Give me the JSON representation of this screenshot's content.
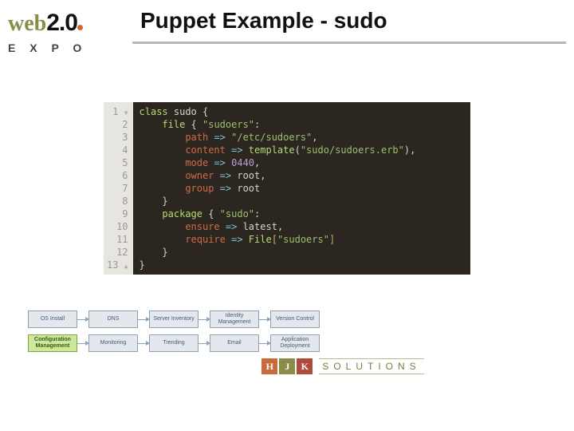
{
  "header": {
    "logo_web": "web",
    "logo_20": "2.0",
    "logo_expo": "E X P O",
    "title": "Puppet Example - sudo"
  },
  "code": {
    "line_numbers": [
      "1",
      "2",
      "3",
      "4",
      "5",
      "6",
      "7",
      "8",
      "9",
      "10",
      "11",
      "12",
      "13"
    ],
    "tokens": [
      [
        {
          "t": "class ",
          "c": "kw"
        },
        {
          "t": "sudo ",
          "c": "id"
        },
        {
          "t": "{",
          "c": "punc"
        }
      ],
      [
        {
          "t": "    ",
          "c": "id"
        },
        {
          "t": "file ",
          "c": "kw"
        },
        {
          "t": "{ ",
          "c": "punc"
        },
        {
          "t": "\"sudoers\"",
          "c": "str"
        },
        {
          "t": ":",
          "c": "punc"
        }
      ],
      [
        {
          "t": "        ",
          "c": "id"
        },
        {
          "t": "path ",
          "c": "attr"
        },
        {
          "t": "=> ",
          "c": "op"
        },
        {
          "t": "\"/etc/sudoers\"",
          "c": "str"
        },
        {
          "t": ",",
          "c": "punc"
        }
      ],
      [
        {
          "t": "        ",
          "c": "id"
        },
        {
          "t": "content ",
          "c": "attr"
        },
        {
          "t": "=> ",
          "c": "op"
        },
        {
          "t": "template",
          "c": "kw"
        },
        {
          "t": "(",
          "c": "punc"
        },
        {
          "t": "\"sudo/sudoers.erb\"",
          "c": "str"
        },
        {
          "t": "),",
          "c": "punc"
        }
      ],
      [
        {
          "t": "        ",
          "c": "id"
        },
        {
          "t": "mode ",
          "c": "attr"
        },
        {
          "t": "=> ",
          "c": "op"
        },
        {
          "t": "0440",
          "c": "num"
        },
        {
          "t": ",",
          "c": "punc"
        }
      ],
      [
        {
          "t": "        ",
          "c": "id"
        },
        {
          "t": "owner ",
          "c": "attr"
        },
        {
          "t": "=> ",
          "c": "op"
        },
        {
          "t": "root",
          "c": "id"
        },
        {
          "t": ",",
          "c": "punc"
        }
      ],
      [
        {
          "t": "        ",
          "c": "id"
        },
        {
          "t": "group ",
          "c": "attr"
        },
        {
          "t": "=> ",
          "c": "op"
        },
        {
          "t": "root",
          "c": "id"
        }
      ],
      [
        {
          "t": "    ",
          "c": "id"
        },
        {
          "t": "}",
          "c": "punc"
        }
      ],
      [
        {
          "t": "    ",
          "c": "id"
        },
        {
          "t": "package ",
          "c": "kw"
        },
        {
          "t": "{ ",
          "c": "punc"
        },
        {
          "t": "\"sudo\"",
          "c": "str"
        },
        {
          "t": ":",
          "c": "punc"
        }
      ],
      [
        {
          "t": "        ",
          "c": "id"
        },
        {
          "t": "ensure ",
          "c": "attr"
        },
        {
          "t": "=> ",
          "c": "op"
        },
        {
          "t": "latest",
          "c": "id"
        },
        {
          "t": ",",
          "c": "punc"
        }
      ],
      [
        {
          "t": "        ",
          "c": "id"
        },
        {
          "t": "require ",
          "c": "attr"
        },
        {
          "t": "=> ",
          "c": "op"
        },
        {
          "t": "File",
          "c": "kw"
        },
        {
          "t": "[",
          "c": "br"
        },
        {
          "t": "\"sudoers\"",
          "c": "str"
        },
        {
          "t": "]",
          "c": "br"
        }
      ],
      [
        {
          "t": "    ",
          "c": "id"
        },
        {
          "t": "}",
          "c": "punc"
        }
      ],
      [
        {
          "t": "}",
          "c": "punc"
        }
      ]
    ]
  },
  "workflow": {
    "rows": [
      [
        "OS Install",
        "DNS",
        "Server Inventory",
        "Identity Management",
        "Version Control"
      ],
      [
        "Configuration Management",
        "Monitoring",
        "Trending",
        "Email",
        "Application Deployment"
      ]
    ],
    "active": "Configuration Management"
  },
  "footer": {
    "h": "H",
    "j": "J",
    "k": "K",
    "text": "SOLUTIONS"
  }
}
